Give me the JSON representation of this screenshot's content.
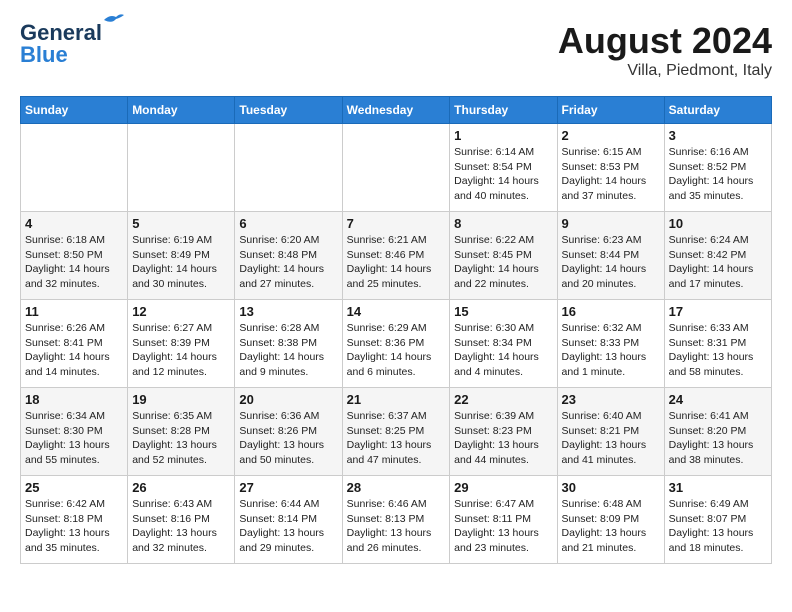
{
  "header": {
    "logo_line1": "General",
    "logo_line2": "Blue",
    "month_year": "August 2024",
    "location": "Villa, Piedmont, Italy"
  },
  "days_of_week": [
    "Sunday",
    "Monday",
    "Tuesday",
    "Wednesday",
    "Thursday",
    "Friday",
    "Saturday"
  ],
  "weeks": [
    [
      {
        "day": "",
        "info": ""
      },
      {
        "day": "",
        "info": ""
      },
      {
        "day": "",
        "info": ""
      },
      {
        "day": "",
        "info": ""
      },
      {
        "day": "1",
        "info": "Sunrise: 6:14 AM\nSunset: 8:54 PM\nDaylight: 14 hours\nand 40 minutes."
      },
      {
        "day": "2",
        "info": "Sunrise: 6:15 AM\nSunset: 8:53 PM\nDaylight: 14 hours\nand 37 minutes."
      },
      {
        "day": "3",
        "info": "Sunrise: 6:16 AM\nSunset: 8:52 PM\nDaylight: 14 hours\nand 35 minutes."
      }
    ],
    [
      {
        "day": "4",
        "info": "Sunrise: 6:18 AM\nSunset: 8:50 PM\nDaylight: 14 hours\nand 32 minutes."
      },
      {
        "day": "5",
        "info": "Sunrise: 6:19 AM\nSunset: 8:49 PM\nDaylight: 14 hours\nand 30 minutes."
      },
      {
        "day": "6",
        "info": "Sunrise: 6:20 AM\nSunset: 8:48 PM\nDaylight: 14 hours\nand 27 minutes."
      },
      {
        "day": "7",
        "info": "Sunrise: 6:21 AM\nSunset: 8:46 PM\nDaylight: 14 hours\nand 25 minutes."
      },
      {
        "day": "8",
        "info": "Sunrise: 6:22 AM\nSunset: 8:45 PM\nDaylight: 14 hours\nand 22 minutes."
      },
      {
        "day": "9",
        "info": "Sunrise: 6:23 AM\nSunset: 8:44 PM\nDaylight: 14 hours\nand 20 minutes."
      },
      {
        "day": "10",
        "info": "Sunrise: 6:24 AM\nSunset: 8:42 PM\nDaylight: 14 hours\nand 17 minutes."
      }
    ],
    [
      {
        "day": "11",
        "info": "Sunrise: 6:26 AM\nSunset: 8:41 PM\nDaylight: 14 hours\nand 14 minutes."
      },
      {
        "day": "12",
        "info": "Sunrise: 6:27 AM\nSunset: 8:39 PM\nDaylight: 14 hours\nand 12 minutes."
      },
      {
        "day": "13",
        "info": "Sunrise: 6:28 AM\nSunset: 8:38 PM\nDaylight: 14 hours\nand 9 minutes."
      },
      {
        "day": "14",
        "info": "Sunrise: 6:29 AM\nSunset: 8:36 PM\nDaylight: 14 hours\nand 6 minutes."
      },
      {
        "day": "15",
        "info": "Sunrise: 6:30 AM\nSunset: 8:34 PM\nDaylight: 14 hours\nand 4 minutes."
      },
      {
        "day": "16",
        "info": "Sunrise: 6:32 AM\nSunset: 8:33 PM\nDaylight: 13 hours\nand 1 minute."
      },
      {
        "day": "17",
        "info": "Sunrise: 6:33 AM\nSunset: 8:31 PM\nDaylight: 13 hours\nand 58 minutes."
      }
    ],
    [
      {
        "day": "18",
        "info": "Sunrise: 6:34 AM\nSunset: 8:30 PM\nDaylight: 13 hours\nand 55 minutes."
      },
      {
        "day": "19",
        "info": "Sunrise: 6:35 AM\nSunset: 8:28 PM\nDaylight: 13 hours\nand 52 minutes."
      },
      {
        "day": "20",
        "info": "Sunrise: 6:36 AM\nSunset: 8:26 PM\nDaylight: 13 hours\nand 50 minutes."
      },
      {
        "day": "21",
        "info": "Sunrise: 6:37 AM\nSunset: 8:25 PM\nDaylight: 13 hours\nand 47 minutes."
      },
      {
        "day": "22",
        "info": "Sunrise: 6:39 AM\nSunset: 8:23 PM\nDaylight: 13 hours\nand 44 minutes."
      },
      {
        "day": "23",
        "info": "Sunrise: 6:40 AM\nSunset: 8:21 PM\nDaylight: 13 hours\nand 41 minutes."
      },
      {
        "day": "24",
        "info": "Sunrise: 6:41 AM\nSunset: 8:20 PM\nDaylight: 13 hours\nand 38 minutes."
      }
    ],
    [
      {
        "day": "25",
        "info": "Sunrise: 6:42 AM\nSunset: 8:18 PM\nDaylight: 13 hours\nand 35 minutes."
      },
      {
        "day": "26",
        "info": "Sunrise: 6:43 AM\nSunset: 8:16 PM\nDaylight: 13 hours\nand 32 minutes."
      },
      {
        "day": "27",
        "info": "Sunrise: 6:44 AM\nSunset: 8:14 PM\nDaylight: 13 hours\nand 29 minutes."
      },
      {
        "day": "28",
        "info": "Sunrise: 6:46 AM\nSunset: 8:13 PM\nDaylight: 13 hours\nand 26 minutes."
      },
      {
        "day": "29",
        "info": "Sunrise: 6:47 AM\nSunset: 8:11 PM\nDaylight: 13 hours\nand 23 minutes."
      },
      {
        "day": "30",
        "info": "Sunrise: 6:48 AM\nSunset: 8:09 PM\nDaylight: 13 hours\nand 21 minutes."
      },
      {
        "day": "31",
        "info": "Sunrise: 6:49 AM\nSunset: 8:07 PM\nDaylight: 13 hours\nand 18 minutes."
      }
    ]
  ]
}
